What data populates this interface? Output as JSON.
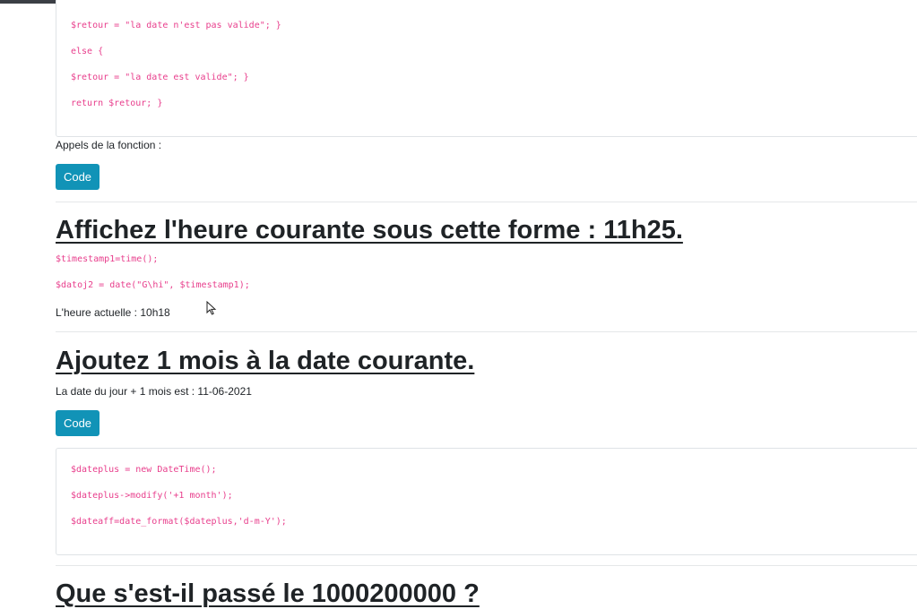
{
  "section_validate": {
    "code_lines": [
      "$retour = \"la date n'est pas valide\"; }",
      "else {",
      "$retour = \"la date est valide\"; }",
      "return $retour; }"
    ],
    "calls_label": "Appels de la fonction :",
    "code_button": "Code"
  },
  "section_hour": {
    "title": "Affichez l'heure courante sous cette forme : 11h25.",
    "code_lines": [
      "$timestamp1=time();",
      "$datoj2 = date(\"G\\hi\", $timestamp1);"
    ],
    "result": "L'heure actuelle : 10h18"
  },
  "section_month": {
    "title": "Ajoutez 1 mois à la date courante.",
    "result": "La date du jour + 1 mois est : 11-06-2021",
    "code_button": "Code",
    "code_lines": [
      "$dateplus = new DateTime();",
      "$dateplus->modify('+1 month');",
      "$dateaff=date_format($dateplus,'d-m-Y');"
    ]
  },
  "section_next": {
    "title": "Que s'est-il passé le 1000200000 ?"
  },
  "icons": {
    "cursor": "mouse-pointer-icon"
  },
  "colors": {
    "code": "#e83e8c",
    "button": "#1193b7",
    "text": "#212529"
  }
}
